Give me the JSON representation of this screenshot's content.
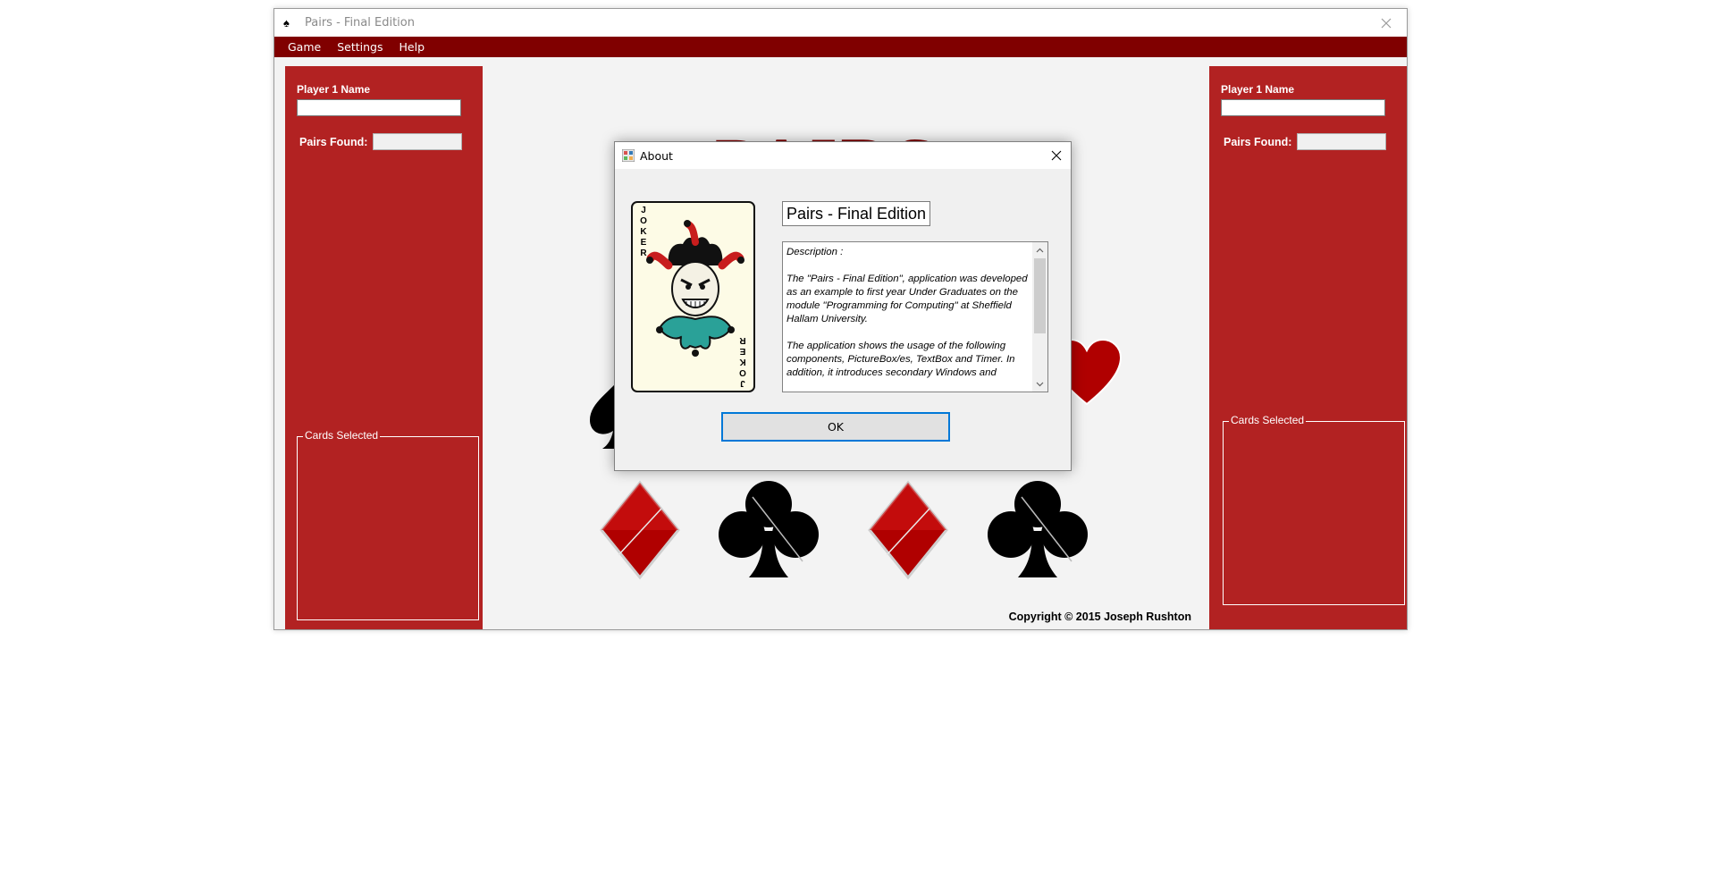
{
  "window": {
    "title": "Pairs - Final Edition",
    "icon": "spade-card-icon"
  },
  "menu": {
    "items": [
      "Game",
      "Settings",
      "Help"
    ]
  },
  "left_panel": {
    "name_label": "Player 1 Name",
    "name_value": "",
    "pairs_label": "Pairs Found:",
    "pairs_value": "",
    "cards_group_label": "Cards Selected"
  },
  "right_panel": {
    "name_label": "Player 1 Name",
    "name_value": "",
    "pairs_label": "Pairs Found:",
    "pairs_value": "",
    "cards_group_label": "Cards Selected"
  },
  "game": {
    "title_text": "PAIRS",
    "copyright": "Copyright © 2015 Joseph Rushton",
    "suits": [
      "spade",
      "heart",
      "diamond",
      "club",
      "diamond",
      "club"
    ],
    "colors": {
      "red": "#b22222",
      "dark_red": "#800000",
      "black": "#000000"
    }
  },
  "about": {
    "title": "About",
    "product_name": "Pairs - Final Edition",
    "card_letters": "JOKER",
    "description": "Description :\n\nThe \"Pairs - Final Edition\", application was developed as an example to first year Under Graduates on the module \"Programming for Computing\" at Sheffield Hallam University.\n\nThe application shows the usage of the following components, PictureBox/es, TextBox and Timer. In addition, it introduces secondary Windows and",
    "ok_label": "OK"
  }
}
